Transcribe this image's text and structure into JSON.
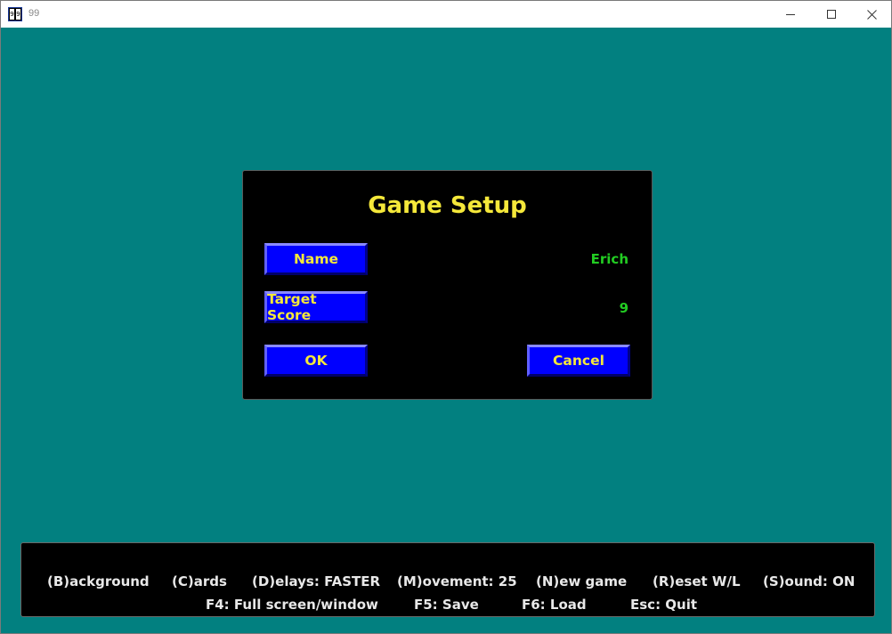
{
  "window": {
    "title": "99",
    "icon": "playing-card-app-icon",
    "controls": [
      "minimize-icon",
      "maximize-icon",
      "close-icon"
    ]
  },
  "colors": {
    "background": "#028080",
    "dialog": "#000000",
    "button_face": "#0000ff",
    "button_text": "#f5e83a",
    "title_text": "#f5e83a",
    "value_text": "#22cc22",
    "help_text": "#e8e8e8"
  },
  "dialog": {
    "title": "Game Setup",
    "name_button": "Name",
    "name_value": "Erich",
    "target_button": "Target Score",
    "target_value": "9",
    "ok_button": "OK",
    "cancel_button": "Cancel"
  },
  "helpbar": {
    "row1": [
      "(B)ackground",
      "(C)ards",
      "(D)elays: FASTER",
      "(M)ovement: 25",
      "(N)ew game",
      "(R)eset W/L",
      "(S)ound: ON"
    ],
    "row2": [
      "F4: Full screen/window",
      "F5: Save",
      "F6: Load",
      "Esc: Quit"
    ]
  }
}
